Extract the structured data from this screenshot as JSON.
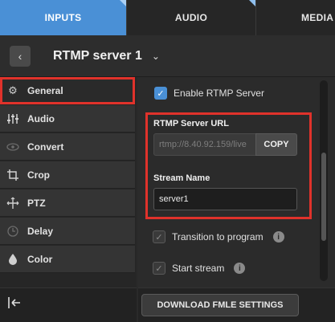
{
  "tabs": [
    {
      "label": "INPUTS",
      "active": true
    },
    {
      "label": "AUDIO",
      "active": false
    },
    {
      "label": "MEDIA",
      "active": false
    }
  ],
  "header": {
    "title": "RTMP server 1",
    "back_icon": "chevron-left-icon",
    "dropdown_icon": "chevron-down-icon"
  },
  "sidebar": {
    "items": [
      {
        "label": "General",
        "icon": "gear-icon",
        "selected": true
      },
      {
        "label": "Audio",
        "icon": "sliders-icon",
        "selected": false
      },
      {
        "label": "Convert",
        "icon": "eye-icon",
        "selected": false
      },
      {
        "label": "Crop",
        "icon": "crop-icon",
        "selected": false
      },
      {
        "label": "PTZ",
        "icon": "move-icon",
        "selected": false
      },
      {
        "label": "Delay",
        "icon": "clock-icon",
        "selected": false
      },
      {
        "label": "Color",
        "icon": "droplet-icon",
        "selected": false
      }
    ],
    "collapse_icon": "collapse-left-icon"
  },
  "general": {
    "enable_rtmp_label": "Enable RTMP Server",
    "enable_rtmp_checked": true,
    "rtmp_url_label": "RTMP Server URL",
    "rtmp_url_value": "rtmp://8.40.92.159/live",
    "copy_label": "COPY",
    "stream_name_label": "Stream Name",
    "stream_name_value": "server1",
    "transition_label": "Transition to program",
    "transition_checked": true,
    "start_stream_label": "Start stream",
    "start_stream_checked": true,
    "download_label": "DOWNLOAD FMLE SETTINGS"
  },
  "colors": {
    "accent": "#4a90d6",
    "highlight": "#e0322b"
  }
}
